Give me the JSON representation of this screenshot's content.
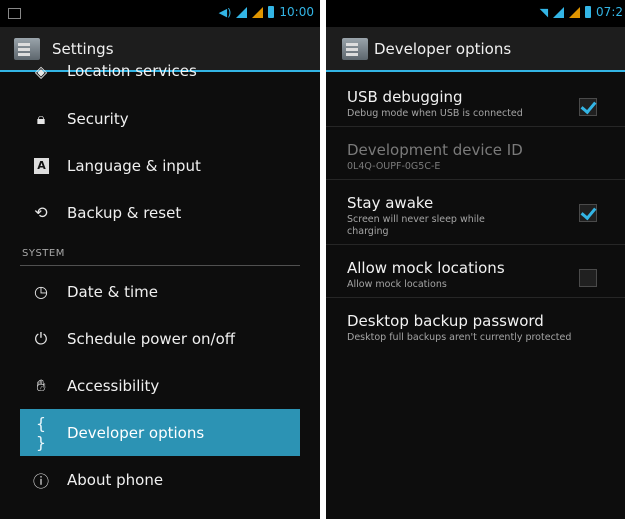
{
  "left": {
    "status_time": "10:00",
    "title": "Settings",
    "items_top": [
      {
        "label": "Location services",
        "icon": "location-icon"
      },
      {
        "label": "Security",
        "icon": "lock-icon"
      },
      {
        "label": "Language & input",
        "icon": "keyboard-a-icon"
      },
      {
        "label": "Backup & reset",
        "icon": "backup-icon"
      }
    ],
    "section_header": "SYSTEM",
    "items_system": [
      {
        "label": "Date & time",
        "icon": "clock-icon"
      },
      {
        "label": "Schedule power on/off",
        "icon": "power-schedule-icon"
      },
      {
        "label": "Accessibility",
        "icon": "hand-icon"
      },
      {
        "label": "Developer options",
        "icon": "braces-icon",
        "glyph": "{ }"
      },
      {
        "label": "About phone",
        "icon": "info-icon"
      }
    ]
  },
  "right": {
    "status_time": "07:2",
    "title": "Developer options",
    "options": [
      {
        "title": "USB debugging",
        "summary": "Debug mode when USB is connected",
        "checked": true
      },
      {
        "title": "Development device ID",
        "summary": "0L4Q-OUPF-0G5C-E",
        "checked": null
      },
      {
        "title": "Stay awake",
        "summary": "Screen will never sleep while charging",
        "checked": true
      },
      {
        "title": "Allow mock locations",
        "summary": "Allow mock locations",
        "checked": false
      },
      {
        "title": "Desktop backup password",
        "summary": "Desktop full backups aren't currently protected",
        "checked": null
      }
    ]
  },
  "colors": {
    "accent": "#33b5e5",
    "selected_bg": "#2c93b4",
    "background": "#0d0d0d"
  }
}
